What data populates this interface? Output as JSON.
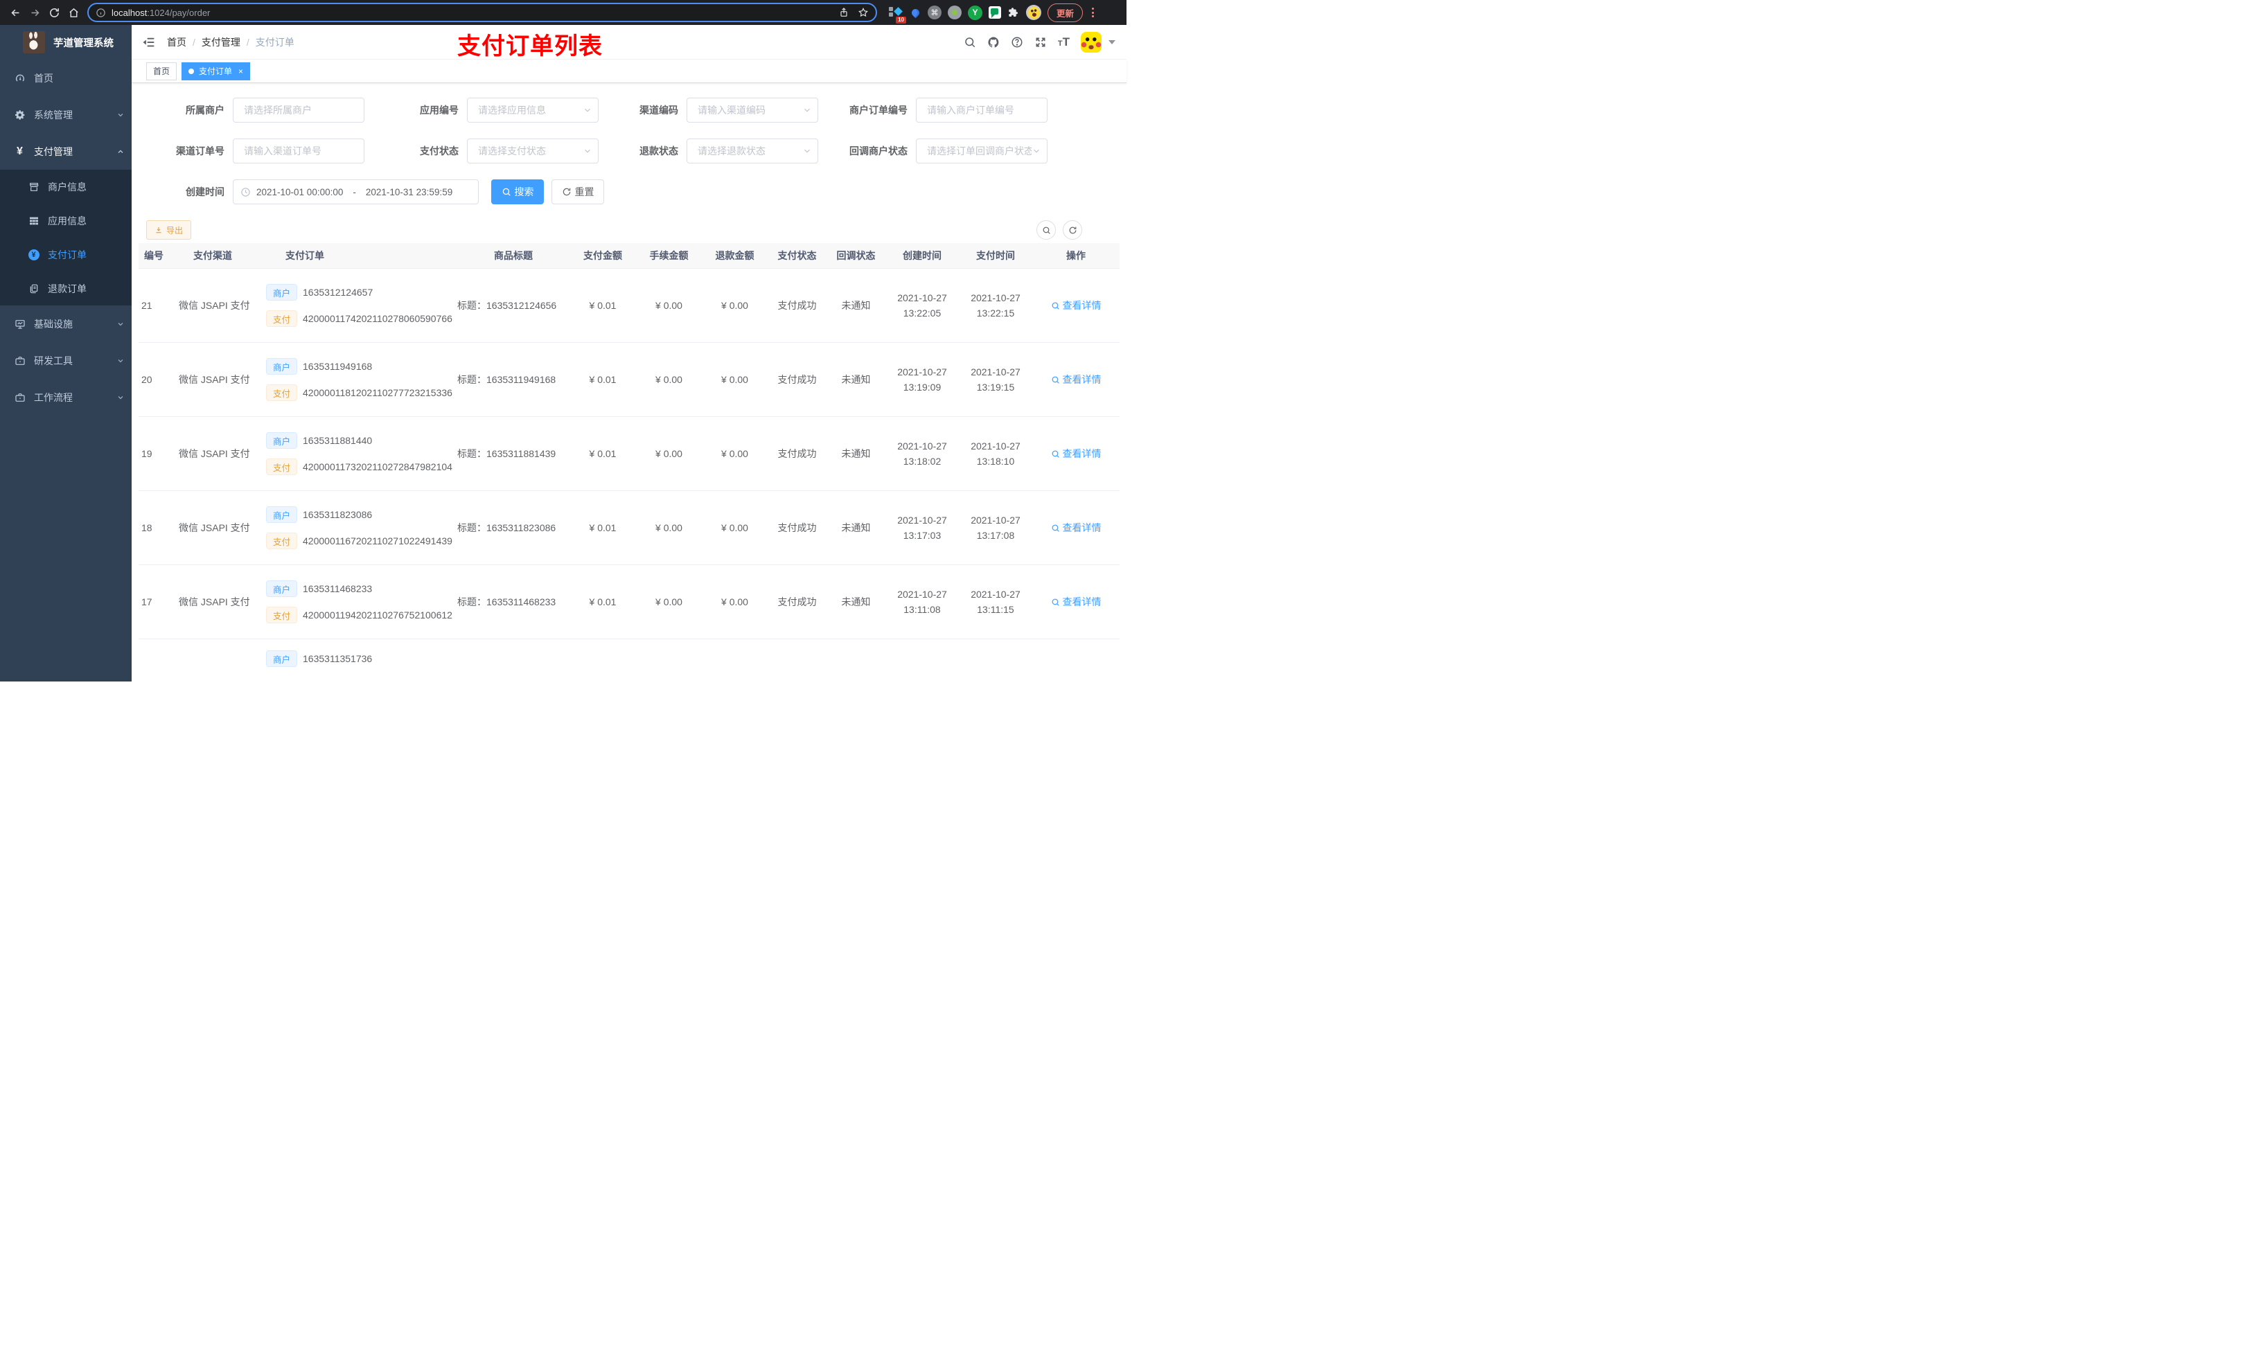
{
  "browser": {
    "url_host": "localhost",
    "url_rest": ":1024/pay/order",
    "ext_badge": "10",
    "update_label": "更新"
  },
  "sidebar": {
    "title": "芋道管理系统",
    "items": [
      {
        "label": "首页"
      },
      {
        "label": "系统管理"
      },
      {
        "label": "支付管理"
      },
      {
        "label": "商户信息"
      },
      {
        "label": "应用信息"
      },
      {
        "label": "支付订单"
      },
      {
        "label": "退款订单"
      },
      {
        "label": "基础设施"
      },
      {
        "label": "研发工具"
      },
      {
        "label": "工作流程"
      }
    ]
  },
  "navbar": {
    "breadcrumb": [
      "首页",
      "支付管理",
      "支付订单"
    ],
    "annotation": "支付订单列表"
  },
  "tags": {
    "home": "首页",
    "current": "支付订单",
    "close": "×"
  },
  "filters": {
    "merchant": {
      "label": "所属商户",
      "placeholder": "请选择所属商户"
    },
    "app": {
      "label": "应用编号",
      "placeholder": "请选择应用信息"
    },
    "channel_code": {
      "label": "渠道编码",
      "placeholder": "请输入渠道编码"
    },
    "merchant_order_no": {
      "label": "商户订单编号",
      "placeholder": "请输入商户订单编号"
    },
    "channel_order_no": {
      "label": "渠道订单号",
      "placeholder": "请输入渠道订单号"
    },
    "pay_status": {
      "label": "支付状态",
      "placeholder": "请选择支付状态"
    },
    "refund_status": {
      "label": "退款状态",
      "placeholder": "请选择退款状态"
    },
    "callback_status": {
      "label": "回调商户状态",
      "placeholder": "请选择订单回调商户状态"
    },
    "create_time": {
      "label": "创建时间",
      "start": "2021-10-01 00:00:00",
      "separator": "-",
      "end": "2021-10-31 23:59:59"
    },
    "search_label": "搜索",
    "reset_label": "重置"
  },
  "toolbar": {
    "export_label": "导出"
  },
  "table": {
    "columns": {
      "id": "编号",
      "channel": "支付渠道",
      "order": "支付订单",
      "title": "商品标题",
      "amount": "支付金额",
      "fee": "手续金额",
      "refund": "退款金额",
      "pay_status": "支付状态",
      "notify_status": "回调状态",
      "create_time": "创建时间",
      "pay_time": "支付时间",
      "action": "操作"
    },
    "tag_merchant": "商户",
    "tag_pay": "支付",
    "action_label": "查看详情",
    "rows": [
      {
        "id": "21",
        "channel": "微信 JSAPI 支付",
        "merchant_no": "1635312124657",
        "pay_no": "4200001174202110278060590766",
        "title": "标题：1635312124656",
        "amount": "¥ 0.01",
        "fee": "¥ 0.00",
        "refund": "¥ 0.00",
        "pay_status": "支付成功",
        "notify_status": "未通知",
        "create_date": "2021-10-27",
        "create_clock": "13:22:05",
        "pay_date": "2021-10-27",
        "pay_clock": "13:22:15"
      },
      {
        "id": "20",
        "channel": "微信 JSAPI 支付",
        "merchant_no": "1635311949168",
        "pay_no": "4200001181202110277723215336",
        "title": "标题：1635311949168",
        "amount": "¥ 0.01",
        "fee": "¥ 0.00",
        "refund": "¥ 0.00",
        "pay_status": "支付成功",
        "notify_status": "未通知",
        "create_date": "2021-10-27",
        "create_clock": "13:19:09",
        "pay_date": "2021-10-27",
        "pay_clock": "13:19:15"
      },
      {
        "id": "19",
        "channel": "微信 JSAPI 支付",
        "merchant_no": "1635311881440",
        "pay_no": "4200001173202110272847982104",
        "title": "标题：1635311881439",
        "amount": "¥ 0.01",
        "fee": "¥ 0.00",
        "refund": "¥ 0.00",
        "pay_status": "支付成功",
        "notify_status": "未通知",
        "create_date": "2021-10-27",
        "create_clock": "13:18:02",
        "pay_date": "2021-10-27",
        "pay_clock": "13:18:10"
      },
      {
        "id": "18",
        "channel": "微信 JSAPI 支付",
        "merchant_no": "1635311823086",
        "pay_no": "4200001167202110271022491439",
        "title": "标题：1635311823086",
        "amount": "¥ 0.01",
        "fee": "¥ 0.00",
        "refund": "¥ 0.00",
        "pay_status": "支付成功",
        "notify_status": "未通知",
        "create_date": "2021-10-27",
        "create_clock": "13:17:03",
        "pay_date": "2021-10-27",
        "pay_clock": "13:17:08"
      },
      {
        "id": "17",
        "channel": "微信 JSAPI 支付",
        "merchant_no": "1635311468233",
        "pay_no": "4200001194202110276752100612",
        "title": "标题：1635311468233",
        "amount": "¥ 0.01",
        "fee": "¥ 0.00",
        "refund": "¥ 0.00",
        "pay_status": "支付成功",
        "notify_status": "未通知",
        "create_date": "2021-10-27",
        "create_clock": "13:11:08",
        "pay_date": "2021-10-27",
        "pay_clock": "13:11:15"
      },
      {
        "merchant_no": "1635311351736"
      }
    ]
  }
}
